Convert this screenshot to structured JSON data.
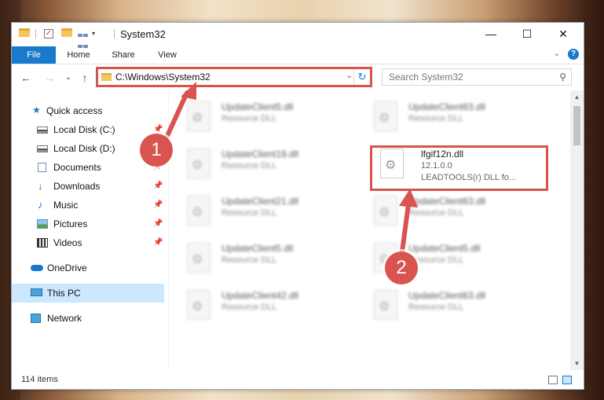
{
  "window": {
    "title": "System32",
    "controls": {
      "minimize": "—",
      "maximize": "☐",
      "close": "✕"
    }
  },
  "quick_access_toolbar": {
    "dropdown_arrow": "▾"
  },
  "ribbon": {
    "tabs": [
      "File",
      "Home",
      "Share",
      "View"
    ],
    "collapse_caret": "⌄",
    "help": "?"
  },
  "navigation": {
    "back": "←",
    "forward": "→",
    "recent": "⌄",
    "up": "↑",
    "address_path": "C:\\Windows\\System32",
    "address_dropdown": "⌄",
    "refresh": "↻",
    "search_placeholder": "Search System32",
    "search_icon": "⚲"
  },
  "sidebar": {
    "items": [
      {
        "label": "Quick access",
        "icon": "star-icon",
        "pinned": false
      },
      {
        "label": "Local Disk (C:)",
        "icon": "disk-icon",
        "pinned": true
      },
      {
        "label": "Local Disk (D:)",
        "icon": "disk-icon",
        "pinned": false
      },
      {
        "label": "Documents",
        "icon": "documents-icon",
        "pinned": true
      },
      {
        "label": "Downloads",
        "icon": "downloads-icon",
        "pinned": true
      },
      {
        "label": "Music",
        "icon": "music-icon",
        "pinned": true
      },
      {
        "label": "Pictures",
        "icon": "pictures-icon",
        "pinned": true
      },
      {
        "label": "Videos",
        "icon": "videos-icon",
        "pinned": true
      },
      {
        "label": "OneDrive",
        "icon": "onedrive-icon",
        "pinned": false
      },
      {
        "label": "This PC",
        "icon": "this-pc-icon",
        "pinned": false,
        "selected": true
      },
      {
        "label": "Network",
        "icon": "network-icon",
        "pinned": false
      }
    ],
    "pin_glyph": "📌"
  },
  "files": [
    {
      "name": "UpdateClient5.dll",
      "type": "Resource DLL"
    },
    {
      "name": "UpdateClient63.dll",
      "type": "Resource DLL"
    },
    {
      "name": "UpdateClient19.dll",
      "type": "Resource DLL"
    },
    {
      "name": "lfgif12n.dll",
      "version": "12.1.0.0",
      "description": "LEADTOOLS(r) DLL fo...",
      "highlighted": true
    },
    {
      "name": "UpdateClient21.dll",
      "type": "Resource DLL"
    },
    {
      "name": "UpdateClient63.dll",
      "type": "Resource DLL"
    },
    {
      "name": "UpdateClient5.dll",
      "type": "Resource DLL"
    },
    {
      "name": "UpdateClient5.dll",
      "type": "Resource DLL"
    },
    {
      "name": "UpdateClient42.dll",
      "type": "Resource DLL"
    },
    {
      "name": "UpdateClient63.dll",
      "type": "Resource DLL"
    }
  ],
  "status": {
    "item_count": "114 items"
  },
  "callouts": [
    "1",
    "2"
  ],
  "colors": {
    "accent": "#1979ca",
    "highlight": "#d9534f",
    "selected_bg": "#cce8ff"
  }
}
